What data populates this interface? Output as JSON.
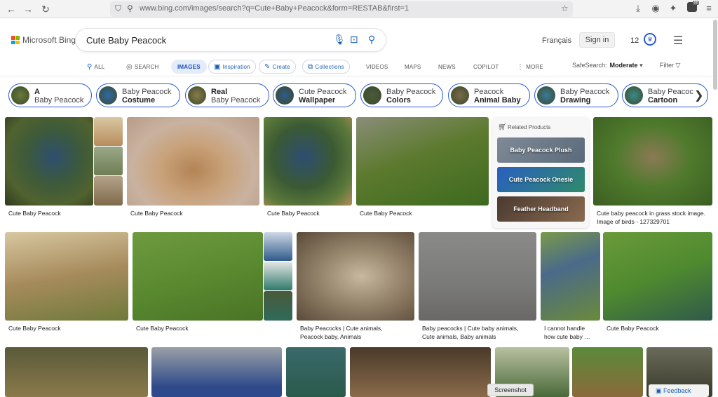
{
  "browser": {
    "url": "www.bing.com/images/search?q=Cute+Baby+Peacock&form=RESTAB&first=1",
    "extension_badge": "68"
  },
  "header": {
    "logo_text": "Microsoft Bing",
    "search_query": "Cute Baby Peacock",
    "language": "Français",
    "signin_label": "Sign in",
    "rewards_count": "12"
  },
  "tabs": [
    {
      "label": "ALL"
    },
    {
      "label": "SEARCH"
    },
    {
      "label": "IMAGES"
    },
    {
      "label": "Inspiration"
    },
    {
      "label": "Create"
    },
    {
      "label": "Collections"
    },
    {
      "label": "VIDEOS"
    },
    {
      "label": "MAPS"
    },
    {
      "label": "NEWS"
    },
    {
      "label": "COPILOT"
    },
    {
      "label": "MORE"
    }
  ],
  "safesearch": {
    "label": "SafeSearch:",
    "value": "Moderate"
  },
  "filter_label": "Filter",
  "chips": [
    {
      "line1": "A",
      "line2": "Baby Peacock",
      "bold": 1
    },
    {
      "line1": "Baby Peacock",
      "line2": "Costume",
      "bold": 2
    },
    {
      "line1": "Real",
      "line2": "Baby Peacock",
      "bold": 1
    },
    {
      "line1": "Cute Peacock",
      "line2": "Wallpaper",
      "bold": 2
    },
    {
      "line1": "Baby Peacock",
      "line2": "Colors",
      "bold": 2
    },
    {
      "line1": "Peacock",
      "line2": "Animal Baby",
      "bold": 2
    },
    {
      "line1": "Baby Peacock",
      "line2": "Drawing",
      "bold": 2
    },
    {
      "line1": "Baby Peacoc",
      "line2": "Cartoon",
      "bold": 2
    }
  ],
  "related_products": {
    "title": "Related Products",
    "items": [
      "Baby Peacock Plush",
      "Cute Peacock Onesie",
      "Feather Headband"
    ]
  },
  "captions": {
    "r1": [
      "Cute Baby Peacock",
      "Cute Baby Peacock",
      "Cute Baby Peacock",
      "Cute Baby Peacock",
      "Cute baby peacock in grass stock image.",
      "Image of birds - 127329701"
    ],
    "r2": [
      "Cute Baby Peacock",
      "Cute Baby Peacock",
      "Baby Peacocks | Cute animals,",
      "Peacock baby, Animals",
      "Baby peacocks | Cute baby animals,",
      "Cute animals, Baby animals",
      "I cannot handle",
      "how cute baby …",
      "Cute Baby Peacock"
    ]
  },
  "screenshot_label": "Screenshot",
  "feedback_label": "Feedback",
  "colors": {
    "accent": "#2a5bd7",
    "tab_active_bg": "#e4ecfa"
  }
}
